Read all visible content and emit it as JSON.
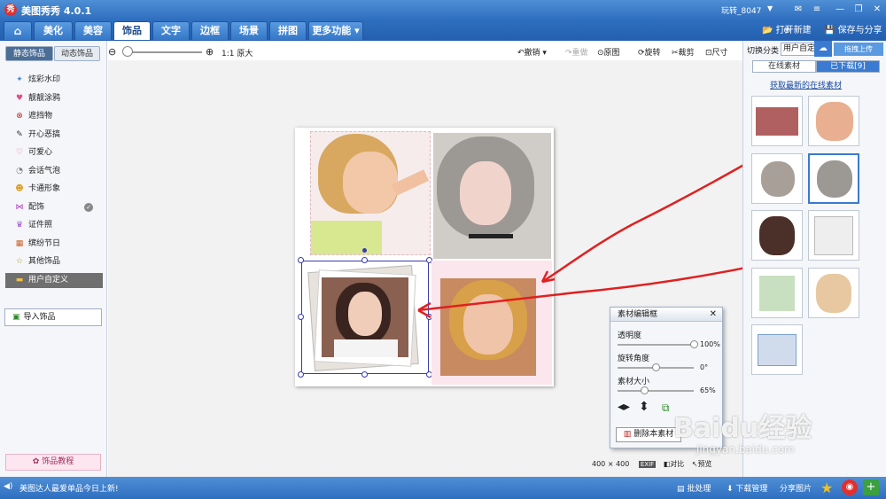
{
  "app": {
    "title": "美图秀秀 4.0.1",
    "user": "玩转_8047"
  },
  "nav": {
    "tabs": [
      "美化",
      "美容",
      "饰品",
      "文字",
      "边框",
      "场景",
      "拼图",
      "更多功能"
    ],
    "active": "饰品"
  },
  "toolbar_top": {
    "open": "打开",
    "new": "新建",
    "save": "保存与分享"
  },
  "left": {
    "subtabs": [
      "静态饰品",
      "动态饰品"
    ],
    "categories": [
      "炫彩水印",
      "靓靓涂鸦",
      "遮挡物",
      "开心恶搞",
      "可爱心",
      "会话气泡",
      "卡通形象",
      "配饰",
      "证件照",
      "缤纷节日",
      "其他饰品",
      "用户自定义"
    ],
    "import": "导入饰品",
    "tutorial": "饰品教程"
  },
  "canvas_toolbar": {
    "zoom_label": "1:1 原大",
    "undo": "撤销",
    "redo": "重做",
    "original": "原图",
    "rotate": "旋转",
    "crop": "裁剪",
    "size": "尺寸"
  },
  "material_editor": {
    "title": "素材编辑框",
    "opacity_label": "透明度",
    "opacity": "100%",
    "opacity_level": 1.0,
    "rotate_label": "旋转角度",
    "rotate": "0°",
    "rotate_level": 0.5,
    "size_label": "素材大小",
    "size": "65%",
    "size_level": 0.35,
    "delete": "删除本素材"
  },
  "canvas_info": {
    "size": "400 × 400",
    "badge": "EXIF",
    "compare": "对比",
    "preview": "预览"
  },
  "right": {
    "switch_label": "切换分类",
    "category": "用户自定",
    "upload": "拖拽上传",
    "tabs": [
      "在线素材",
      "已下载[9]"
    ],
    "link": "获取最新的在线素材",
    "thumb_count": 9
  },
  "status": {
    "message": "美图达人最爱单品今日上新!",
    "batch": "批处理",
    "download": "下载管理",
    "share": "分享图片"
  },
  "watermark": {
    "text": "Baidu经验",
    "url": "jingyan.baidu.com"
  }
}
